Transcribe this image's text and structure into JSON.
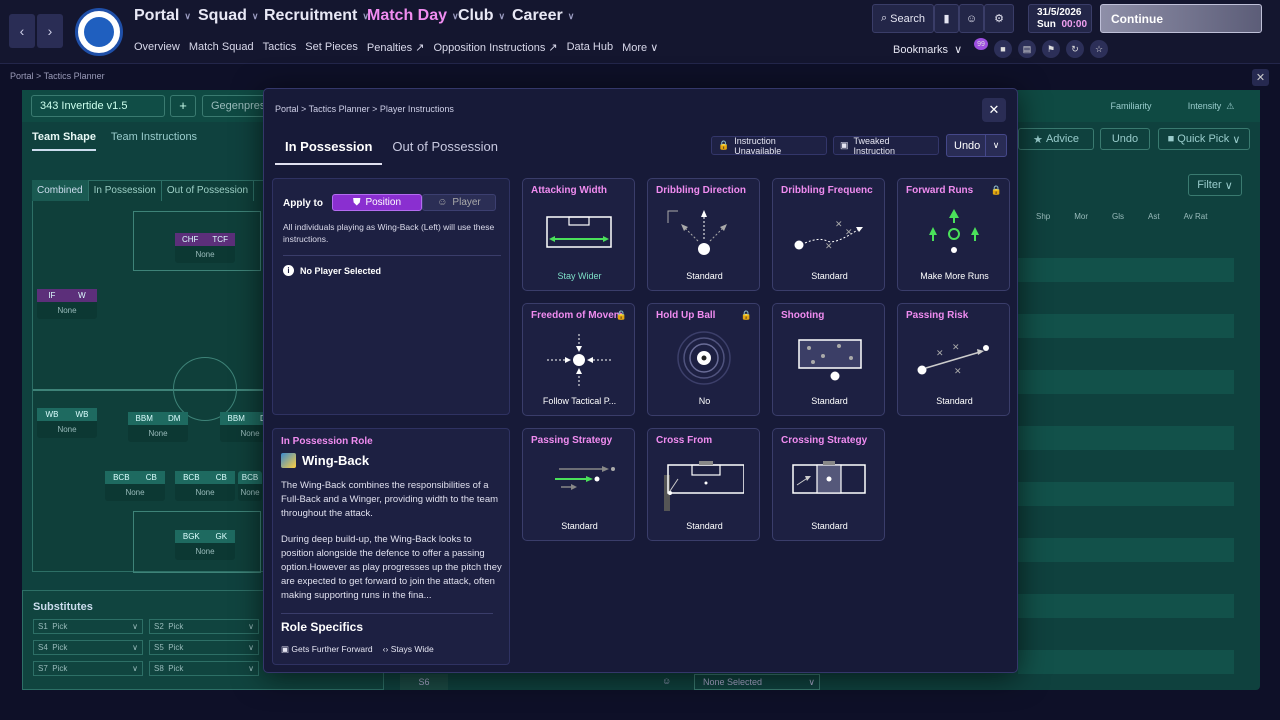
{
  "topbar": {
    "nav": [
      {
        "label": "Portal",
        "active": false
      },
      {
        "label": "Squad",
        "active": false
      },
      {
        "label": "Recruitment",
        "active": false
      },
      {
        "label": "Match Day",
        "active": true
      },
      {
        "label": "Club",
        "active": false
      },
      {
        "label": "Career",
        "active": false
      }
    ],
    "subnav": [
      "Overview",
      "Match Squad",
      "Tactics",
      "Set Pieces",
      "Penalties",
      "Opposition Instructions",
      "Data Hub",
      "More"
    ],
    "search_label": "Search",
    "date": "31/5/2026",
    "day": "Sun",
    "time": "00:00",
    "continue_label": "Continue",
    "bookmarks_label": "Bookmarks",
    "notification_badge": "99"
  },
  "background": {
    "breadcrumb": "Portal > Tactics Planner",
    "tactic_name": "343 Invertide v1.5",
    "tactic_mode": "Gegenpress",
    "tabs": [
      "Team Shape",
      "Team Instructions"
    ],
    "pitch_tabs": [
      "Combined",
      "In Possession",
      "Out of Possession"
    ],
    "familiarity_label": "Familiarity",
    "intensity_label": "Intensity",
    "advice_label": "Advice",
    "undo_label": "Undo",
    "quick_pick_label": "Quick Pick",
    "filter_label": "Filter",
    "columns": [
      "Shp",
      "Mor",
      "Gls",
      "Ast",
      "Av Rat"
    ],
    "none_label": "None",
    "substitutes_label": "Substitutes",
    "subs": [
      {
        "slot": "S1",
        "value": "Pick"
      },
      {
        "slot": "S2",
        "value": "Pick"
      },
      {
        "slot": "S4",
        "value": "Pick"
      },
      {
        "slot": "S5",
        "value": "Pick"
      },
      {
        "slot": "S7",
        "value": "Pick"
      },
      {
        "slot": "S8",
        "value": "Pick"
      }
    ],
    "s6_slot": "S6",
    "s6_value": "None Selected",
    "positions": [
      {
        "a": "CHF",
        "b": "TCF"
      },
      {
        "a": "IF",
        "b": "W"
      },
      {
        "a": "WB",
        "b": "WB"
      },
      {
        "a": "BBM",
        "b": "DM"
      },
      {
        "a": "BBM",
        "b": "DM"
      },
      {
        "a": "BCB",
        "b": "CB"
      },
      {
        "a": "BCB",
        "b": "CB"
      },
      {
        "a": "BCB",
        "b": "CB"
      },
      {
        "a": "BGK",
        "b": "GK"
      }
    ]
  },
  "modal": {
    "breadcrumb": "Portal > Tactics Planner > Player Instructions",
    "tabs": [
      "In Possession",
      "Out of Possession"
    ],
    "legend_unavailable": "Instruction Unavailable",
    "legend_tweaked": "Tweaked Instruction",
    "undo_label": "Undo",
    "apply_to_label": "Apply to",
    "position_btn": "Position",
    "player_btn": "Player",
    "apply_desc": "All individuals playing as Wing-Back (Left) will use these instructions.",
    "no_player": "No Player Selected",
    "role_header": "In Possession Role",
    "role_name": "Wing-Back",
    "role_p1": "The Wing-Back combines the responsibilities of a Full-Back and a Winger, providing width to the team throughout the attack.",
    "role_p2": "During deep build-up, the Wing-Back looks to position alongside the defence to offer a passing option.However as play progresses up the pitch they are expected to get forward to join the attack, often making supporting runs in the fina...",
    "role_specifics": "Role Specifics",
    "specifics": [
      "Gets Further Forward",
      "Stays Wide"
    ],
    "cards": [
      {
        "title": "Attacking Width",
        "value": "Stay Wider",
        "locked": false,
        "tweaked": true
      },
      {
        "title": "Dribbling Direction",
        "value": "Standard",
        "locked": false,
        "tweaked": false
      },
      {
        "title": "Dribbling Frequency",
        "value": "Standard",
        "locked": false,
        "tweaked": false
      },
      {
        "title": "Forward Runs",
        "value": "Make More Runs",
        "locked": true,
        "tweaked": false
      },
      {
        "title": "Freedom of Movement",
        "value": "Follow Tactical P...",
        "locked": true,
        "tweaked": false
      },
      {
        "title": "Hold Up Ball",
        "value": "No",
        "locked": true,
        "tweaked": false
      },
      {
        "title": "Shooting",
        "value": "Standard",
        "locked": false,
        "tweaked": false
      },
      {
        "title": "Passing Risk",
        "value": "Standard",
        "locked": false,
        "tweaked": false
      },
      {
        "title": "Passing Strategy",
        "value": "Standard",
        "locked": false,
        "tweaked": false
      },
      {
        "title": "Cross From",
        "value": "Standard",
        "locked": false,
        "tweaked": false
      },
      {
        "title": "Crossing Strategy",
        "value": "Standard",
        "locked": false,
        "tweaked": false
      }
    ]
  },
  "colors": {
    "accent": "#f08cf0",
    "primary_button": "#8a2fd0",
    "tweaked": "#7ee0c8",
    "pitch": "#0f3f3a"
  }
}
